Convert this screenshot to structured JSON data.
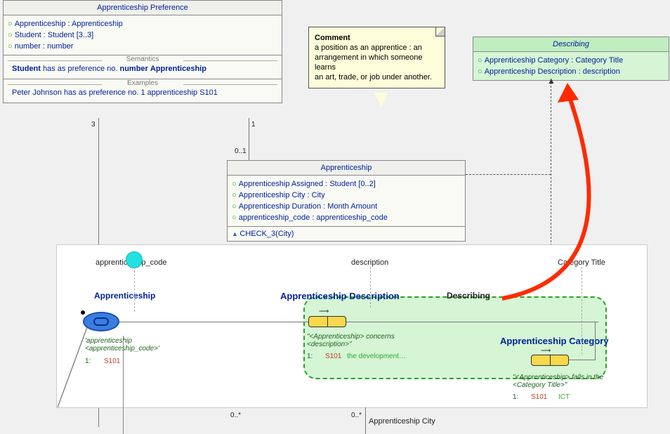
{
  "preference": {
    "title": "Apprenticeship Preference",
    "attrs": [
      "Apprenticeship : Apprenticeship",
      "Student : Student [3..3]",
      "number : number"
    ],
    "semantics_label": "Semantics",
    "semantics_parts": [
      "Student",
      " has as preference no. ",
      "number",
      " ",
      "Apprenticeship"
    ],
    "examples_label": "Examples",
    "examples_text": "Peter Johnson has as preference no. 1 apprenticeship S101"
  },
  "comment": {
    "heading": "Comment",
    "body1": "a position as an apprentice : an",
    "body2": "arrangement in which someone learns",
    "body3": "an art, trade, or job under another."
  },
  "describing": {
    "title": "Describing",
    "attrs": [
      "Apprenticeship Category : Category Title",
      "Apprenticeship Description : description"
    ]
  },
  "apprenticeship": {
    "title": "Apprenticeship",
    "attrs": [
      "Apprenticeship Assigned : Student [0..2]",
      "Apprenticeship City : City",
      "Apprenticeship Duration : Month Amount",
      "apprenticeship_code : apprenticeship_code"
    ],
    "check": "CHECK_3(City)"
  },
  "mults": {
    "three": "3",
    "one": "1",
    "zero_one": "0..1",
    "zero_star_a": "0..*",
    "zero_star_b": "0..*"
  },
  "lower": {
    "apprenticeship_code": "apprenticeship_code",
    "description": "description",
    "category_title": "Category Title",
    "apprenticeship": "Apprenticeship",
    "app_desc": "Apprenticeship Description",
    "describing": "Describing",
    "app_cat": "Apprenticeship Category",
    "ref_app_line1": "'apprenticeship",
    "ref_app_line2": "<apprenticeship_code>'",
    "pop1": "1:",
    "pop1_val": "S101",
    "desc_pred1": "\"<Apprenticeship> concerns",
    "desc_pred2": "<description>\"",
    "desc_pop_val": "the development…",
    "cat_pred1": "\"<Apprenticeship> falls in the",
    "cat_pred2": "<Category Title>\"",
    "cat_pop_val": "ICT",
    "app_city": "Apprenticeship City"
  }
}
